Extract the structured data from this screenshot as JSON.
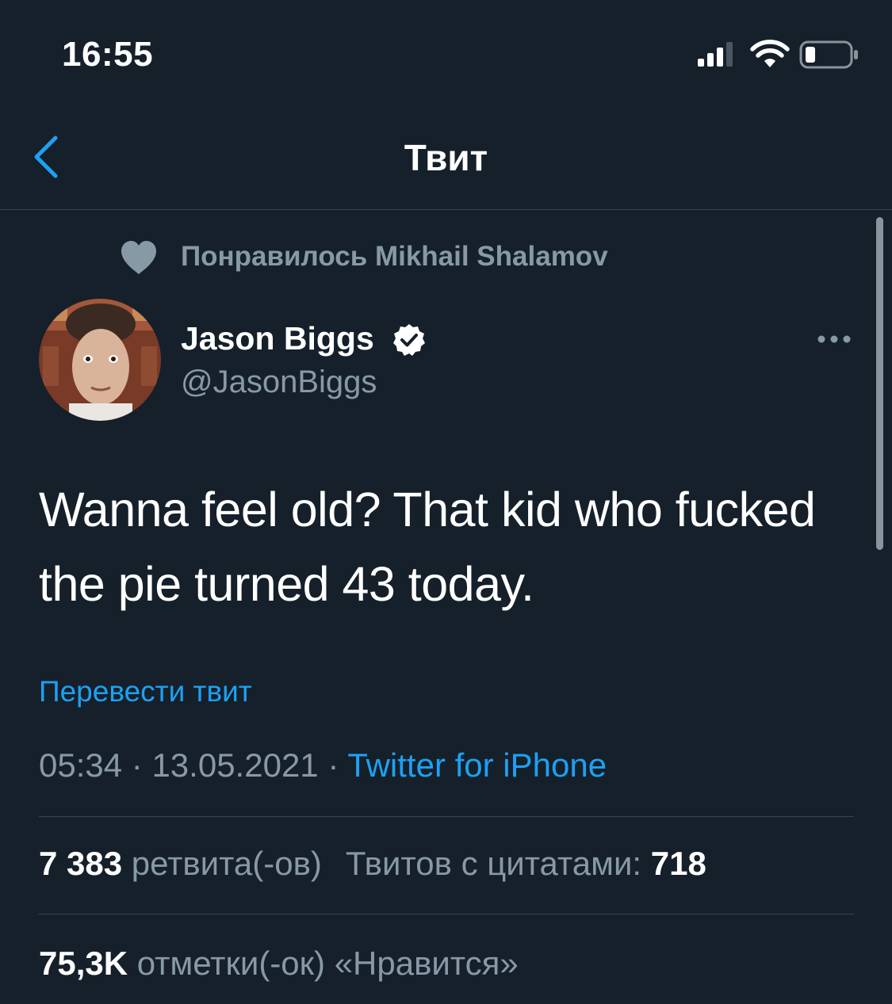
{
  "status_bar": {
    "time": "16:55",
    "icons": [
      "signal-icon",
      "wifi-icon",
      "battery-icon"
    ]
  },
  "nav": {
    "title": "Твит",
    "back_icon": "chevron-left-icon"
  },
  "social_context": {
    "icon": "heart-icon",
    "text": "Понравилось Mikhail Shalamov"
  },
  "author": {
    "name": "Jason Biggs",
    "handle": "@JasonBiggs",
    "verified": true
  },
  "tweet": {
    "text": "Wanna feel old? That kid who fucked the pie turned 43 today.",
    "translate_label": "Перевести твит",
    "time": "05:34",
    "separator": "·",
    "date": "13.05.2021",
    "source": "Twitter for iPhone"
  },
  "stats": {
    "retweets_count": "7 383",
    "retweets_label": "ретвита(-ов)",
    "quotes_label": "Твитов с цитатами:",
    "quotes_count": "718",
    "likes_count": "75,3K",
    "likes_label": "отметки(-ок) «Нравится»"
  },
  "colors": {
    "background": "#15202b",
    "accent": "#1da1f2",
    "secondary_text": "#8899a6",
    "divider": "#38444d"
  }
}
